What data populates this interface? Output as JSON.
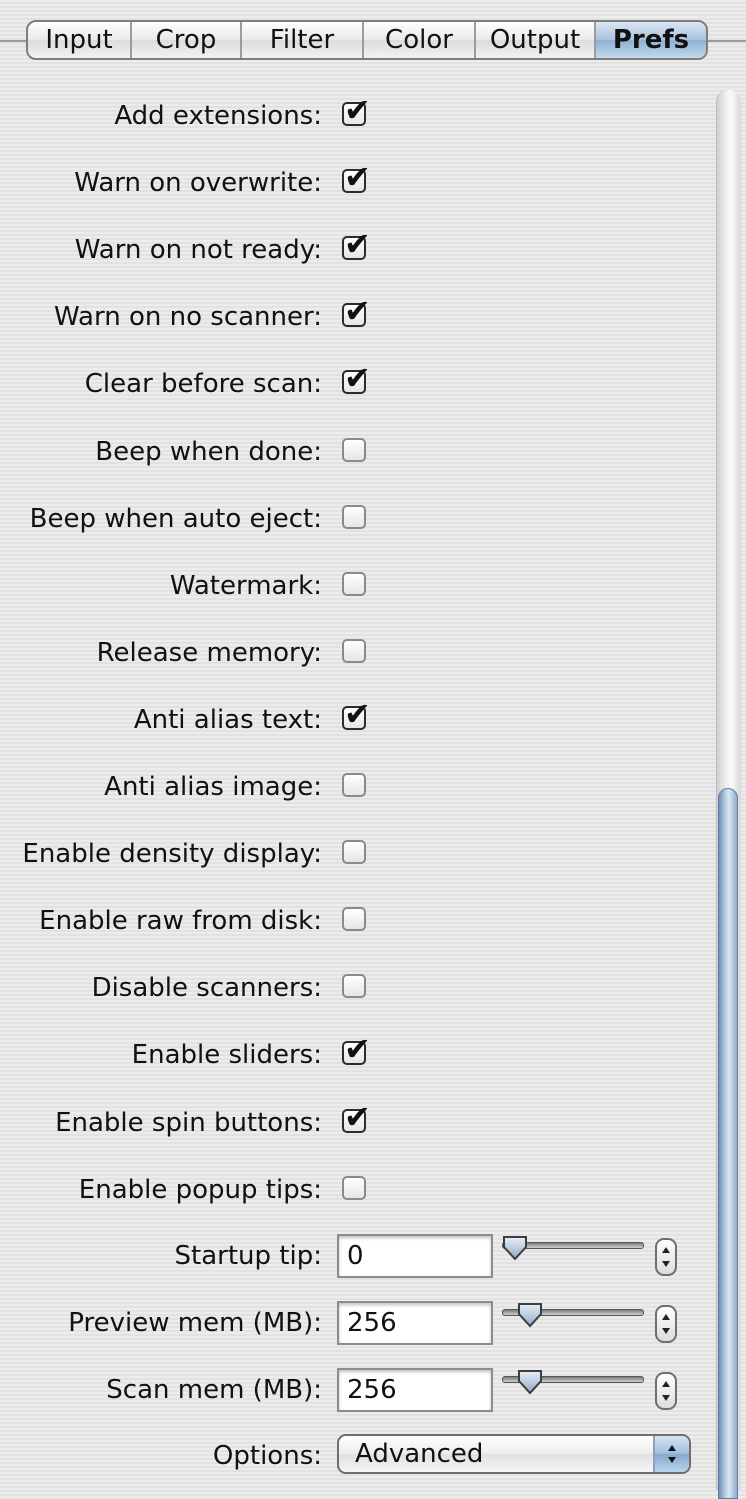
{
  "tabs": [
    {
      "label": "Input",
      "selected": false
    },
    {
      "label": "Crop",
      "selected": false
    },
    {
      "label": "Filter",
      "selected": false
    },
    {
      "label": "Color",
      "selected": false
    },
    {
      "label": "Output",
      "selected": false
    },
    {
      "label": "Prefs",
      "selected": true
    }
  ],
  "checkboxes": [
    {
      "label": "Add extensions:",
      "checked": true
    },
    {
      "label": "Warn on overwrite:",
      "checked": true
    },
    {
      "label": "Warn on not ready:",
      "checked": true
    },
    {
      "label": "Warn on no scanner:",
      "checked": true
    },
    {
      "label": "Clear before scan:",
      "checked": true
    },
    {
      "label": "Beep when done:",
      "checked": false
    },
    {
      "label": "Beep when auto eject:",
      "checked": false
    },
    {
      "label": "Watermark:",
      "checked": false
    },
    {
      "label": "Release memory:",
      "checked": false
    },
    {
      "label": "Anti alias text:",
      "checked": true
    },
    {
      "label": "Anti alias image:",
      "checked": false
    },
    {
      "label": "Enable density display:",
      "checked": false
    },
    {
      "label": "Enable raw from disk:",
      "checked": false
    },
    {
      "label": "Disable scanners:",
      "checked": false
    },
    {
      "label": "Enable sliders:",
      "checked": true
    },
    {
      "label": "Enable spin buttons:",
      "checked": true
    },
    {
      "label": "Enable popup tips:",
      "checked": false
    }
  ],
  "fields": [
    {
      "label": "Startup tip:",
      "value": "0",
      "slider_fraction": 0.09
    },
    {
      "label": "Preview mem (MB):",
      "value": "256",
      "slider_fraction": 0.2
    },
    {
      "label": "Scan mem (MB):",
      "value": "256",
      "slider_fraction": 0.2
    }
  ],
  "options": {
    "label": "Options:",
    "value": "Advanced"
  },
  "checkmark_glyph": "✔",
  "scrollbar": {
    "position_fraction": 1.0
  }
}
